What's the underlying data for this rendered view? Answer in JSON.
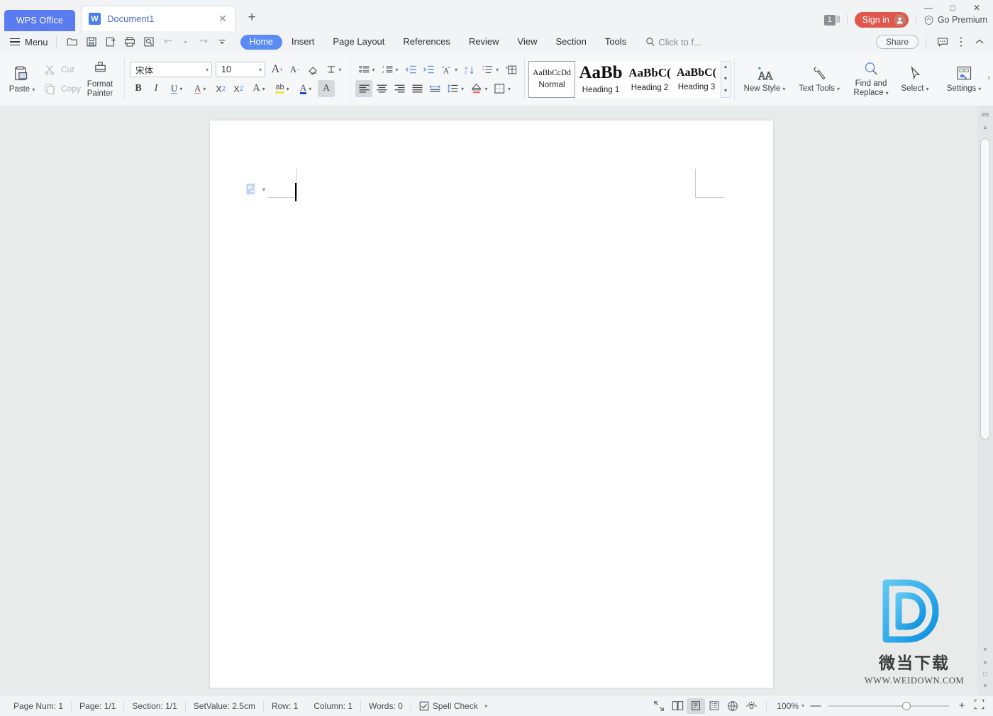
{
  "window": {
    "app_tab_label": "WPS Office",
    "document_tab_label": "Document1",
    "document_tab_icon": "word-doc-icon",
    "new_tab_icon": "plus-icon",
    "close_tab_icon": "close-icon",
    "minimize_icon": "minimize-icon",
    "maximize_icon": "maximize-icon",
    "close_window_icon": "close-window-icon",
    "window_count_badge": "1",
    "sign_in_label": "Sign in",
    "go_premium_label": "Go Premium"
  },
  "menu": {
    "menu_label": "Menu",
    "quick_access": [
      {
        "name": "open-icon",
        "title": "Open"
      },
      {
        "name": "save-icon",
        "title": "Save"
      },
      {
        "name": "save-as-icon",
        "title": "Save As"
      },
      {
        "name": "print-icon",
        "title": "Print"
      },
      {
        "name": "print-preview-icon",
        "title": "Print Preview"
      },
      {
        "name": "undo-icon",
        "title": "Undo"
      },
      {
        "name": "redo-icon",
        "title": "Redo"
      },
      {
        "name": "customize-quick-access-icon",
        "title": "Customize"
      }
    ],
    "tabs": [
      {
        "label": "Home",
        "active": true
      },
      {
        "label": "Insert",
        "active": false
      },
      {
        "label": "Page Layout",
        "active": false
      },
      {
        "label": "References",
        "active": false
      },
      {
        "label": "Review",
        "active": false
      },
      {
        "label": "View",
        "active": false
      },
      {
        "label": "Section",
        "active": false
      },
      {
        "label": "Tools",
        "active": false
      }
    ],
    "search_placeholder": "Click to f...",
    "share_label": "Share",
    "comment_icon": "comment-icon",
    "more_icon": "more-options-icon",
    "collapse_ribbon_icon": "chevron-up-icon"
  },
  "ribbon": {
    "clipboard": {
      "paste_label": "Paste",
      "cut_label": "Cut",
      "copy_label": "Copy",
      "format_painter_label_line1": "Format",
      "format_painter_label_line2": "Painter"
    },
    "font": {
      "font_name": "宋体",
      "font_size": "10",
      "grow_font_label": "A",
      "shrink_font_label": "A",
      "clear_format_icon": "eraser-icon",
      "pinyin_icon": "pinyin-guide-icon",
      "bold_label": "B",
      "italic_label": "I",
      "underline_label": "U",
      "strikethrough_icon": "text-effect-icon",
      "superscript_label": "X",
      "superscript_sup": "2",
      "subscript_label": "X",
      "subscript_sub": "2",
      "char_border_label": "A",
      "highlight_label": "ab",
      "font_color_label": "A",
      "text_effects_label": "A"
    },
    "paragraph": {
      "bullets_icon": "bullet-list-icon",
      "numbering_icon": "numbered-list-icon",
      "decrease_indent_icon": "decrease-indent-icon",
      "increase_indent_icon": "increase-indent-icon",
      "asian_layout_icon": "asian-layout-icon",
      "sort_icon": "sort-icon",
      "line_numbers_icon": "paragraph-layout-icon",
      "table_grid_icon": "insert-table-icon",
      "align_left_icon": "align-left-icon",
      "align_center_icon": "align-center-icon",
      "align_right_icon": "align-right-icon",
      "justify_icon": "justify-icon",
      "distribute_icon": "distributed-align-icon",
      "line_spacing_icon": "line-spacing-icon",
      "shading_icon": "shading-fill-icon",
      "borders_icon": "borders-icon"
    },
    "styles": [
      {
        "preview": "AaBbCcDd",
        "name": "Normal",
        "size": "11.5px",
        "selected": true
      },
      {
        "preview": "AaBb",
        "name": "Heading 1",
        "size": "25px",
        "selected": false
      },
      {
        "preview": "AaBbC(",
        "name": "Heading 2",
        "size": "17px",
        "selected": false
      },
      {
        "preview": "AaBbC(",
        "name": "Heading 3",
        "size": "16px",
        "selected": false
      }
    ],
    "tools": {
      "new_style_label": "New Style",
      "new_style_icon": "new-style-icon",
      "text_tools_label": "Text Tools",
      "text_tools_icon": "wrench-icon",
      "find_replace_label_line1": "Find and",
      "find_replace_label_line2": "Replace",
      "find_replace_icon": "magnifier-icon",
      "select_label": "Select",
      "select_icon": "cursor-arrow-icon",
      "settings_label": "Settings",
      "settings_icon": "settings-panel-icon",
      "expand_icon": "chevron-right-icon"
    }
  },
  "document": {
    "smart_tag_icon": "paste-options-icon",
    "watermark_text_cn": "微当下载",
    "watermark_url": "WWW.WEIDOWN.COM",
    "watermark_letter": "D"
  },
  "status": {
    "items": [
      "Page Num: 1",
      "Page: 1/1",
      "Section: 1/1",
      "SetValue: 2.5cm",
      "Row: 1",
      "Column: 1",
      "Words: 0"
    ],
    "spell_check_label": "Spell Check",
    "spell_check_icon": "spell-check-icon",
    "view_buttons": [
      {
        "name": "full-screen-icon",
        "active": false
      },
      {
        "name": "two-page-view-icon",
        "active": false
      },
      {
        "name": "page-layout-view-icon",
        "active": true
      },
      {
        "name": "outline-view-icon",
        "active": false
      },
      {
        "name": "web-layout-icon",
        "active": false
      },
      {
        "name": "eye-protection-icon",
        "active": false
      }
    ],
    "zoom_level": "100%",
    "zoom_out_icon": "minus-icon",
    "zoom_in_icon": "plus-icon",
    "fit_page_icon": "fit-page-icon"
  },
  "colors": {
    "accent_blue": "#5b8cf5",
    "tab_blue": "#5b7cf0",
    "signin_red": "#e0564b",
    "ribbon_bg": "#f6f7f9",
    "workspace_bg": "#e9eaea",
    "watermark_blue": "#29a9e8"
  }
}
